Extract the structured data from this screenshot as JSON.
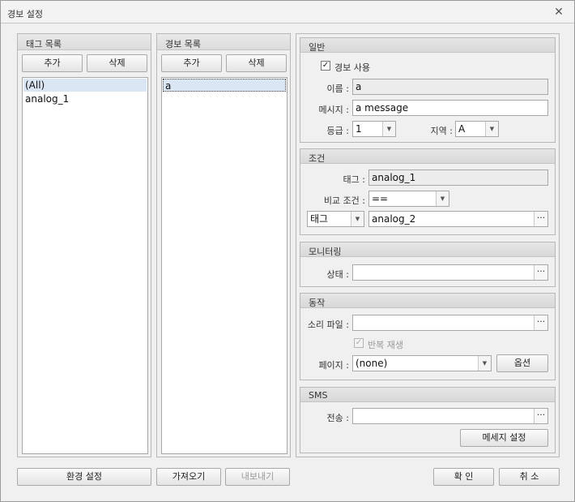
{
  "window": {
    "title": "경보 설정",
    "close_glyph": "✕"
  },
  "tag_list": {
    "title": "태그 목록",
    "add_label": "추가",
    "delete_label": "삭제",
    "items": [
      "(All)",
      "analog_1"
    ]
  },
  "alarm_list": {
    "title": "경보 목록",
    "add_label": "추가",
    "delete_label": "삭제",
    "items": [
      "a"
    ]
  },
  "general": {
    "title": "일반",
    "enable_label": "경보 사용",
    "enable_checked": true,
    "name_label": "이름 :",
    "name_value": "a",
    "message_label": "메시지 :",
    "message_value": "a message",
    "level_label": "등급 :",
    "level_value": "1",
    "area_label": "지역 :",
    "area_value": "A"
  },
  "condition": {
    "title": "조건",
    "tag_label": "태그 :",
    "tag_value": "analog_1",
    "compare_label": "비교 조건 :",
    "compare_value": "==",
    "operand_type": "태그",
    "operand_value": "analog_2"
  },
  "monitoring": {
    "title": "모니터링",
    "state_label": "상태 :",
    "state_value": ""
  },
  "action": {
    "title": "동작",
    "sound_label": "소리 파일 :",
    "sound_value": "",
    "repeat_label": "반복 재생",
    "repeat_checked": true,
    "page_label": "페이지 :",
    "page_value": "(none)",
    "options_label": "옵션"
  },
  "sms": {
    "title": "SMS",
    "send_label": "전송 :",
    "send_value": "",
    "msg_settings_label": "메세지 설정"
  },
  "footer": {
    "env_settings_label": "환경 설정",
    "import_label": "가져오기",
    "export_label": "내보내기",
    "ok_label": "확 인",
    "cancel_label": "취 소"
  },
  "icons": {
    "dropdown": "▼",
    "ellipsis": "···",
    "check": "✓"
  }
}
